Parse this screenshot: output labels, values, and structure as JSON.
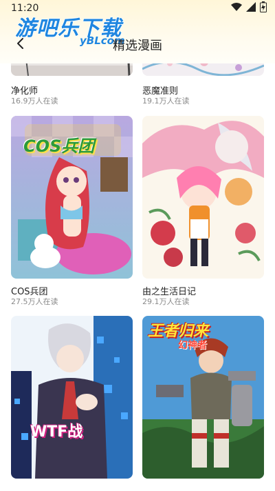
{
  "status": {
    "time": "11:20"
  },
  "watermark": {
    "brand": "游吧乐下载",
    "domain": "yBLcom"
  },
  "header": {
    "title": "精选漫画"
  },
  "comics": [
    {
      "title": "净化师",
      "readers": "16.9万人在读"
    },
    {
      "title": "恶魔准则",
      "readers": "19.1万人在读"
    },
    {
      "title": "COS兵团",
      "readers": "27.5万人在读",
      "cover_text": "COS兵团"
    },
    {
      "title": "由之生活日记",
      "readers": "29.1万人在读"
    },
    {
      "title": "",
      "readers": "",
      "cover_text": "WTF战"
    },
    {
      "title": "",
      "readers": "",
      "cover_text": "王者归来",
      "cover_subtext": "幻神者"
    }
  ]
}
